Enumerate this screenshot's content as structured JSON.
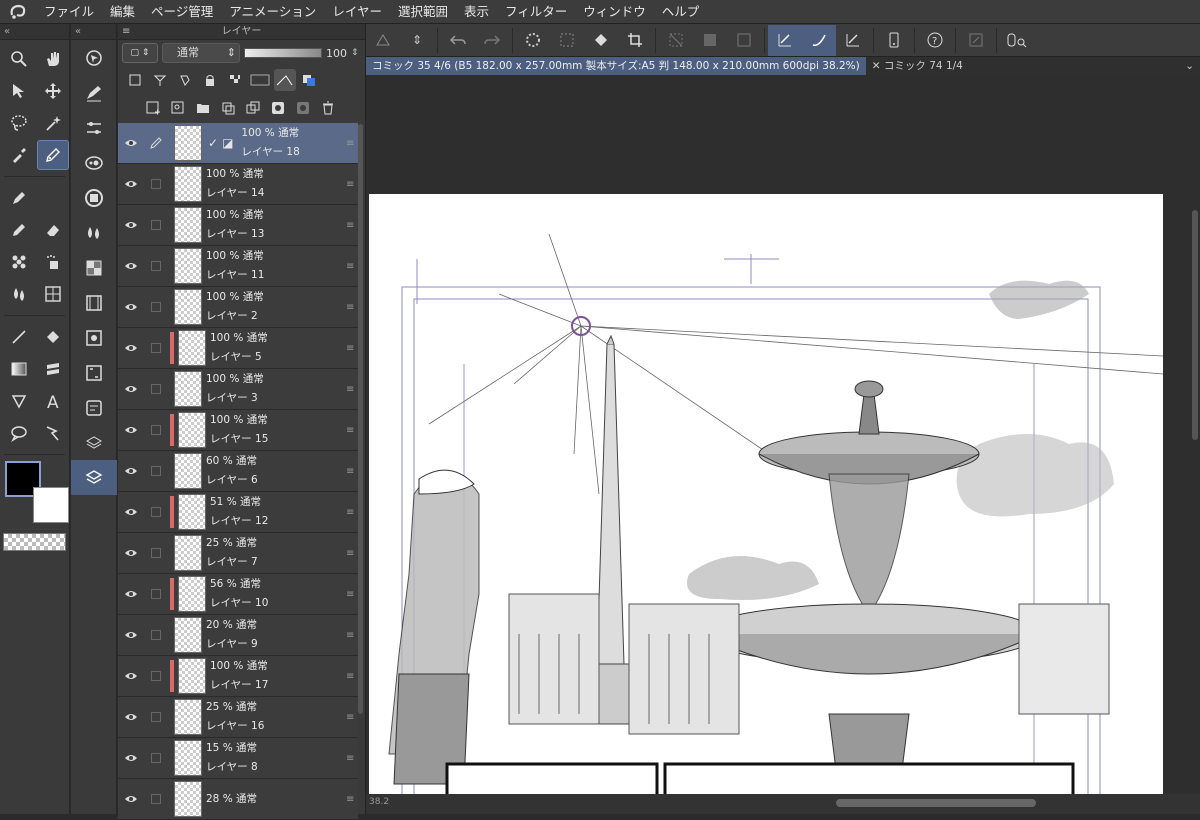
{
  "menu": [
    "ファイル",
    "編集",
    "ページ管理",
    "アニメーション",
    "レイヤー",
    "選択範囲",
    "表示",
    "フィルター",
    "ウィンドウ",
    "ヘルプ"
  ],
  "layer_panel": {
    "title": "レイヤー",
    "blend_mode": "通常",
    "opacity": "100",
    "layers": [
      {
        "percent": "100 % 通常",
        "name": "レイヤー 18",
        "selected": true,
        "marker": false
      },
      {
        "percent": "100 % 通常",
        "name": "レイヤー 14",
        "marker": false
      },
      {
        "percent": "100 % 通常",
        "name": "レイヤー 13",
        "marker": false
      },
      {
        "percent": "100 % 通常",
        "name": "レイヤー 11",
        "marker": false
      },
      {
        "percent": "100 % 通常",
        "name": "レイヤー 2",
        "marker": false
      },
      {
        "percent": "100 % 通常",
        "name": "レイヤー 5",
        "marker": true
      },
      {
        "percent": "100 % 通常",
        "name": "レイヤー 3",
        "marker": false
      },
      {
        "percent": "100 % 通常",
        "name": "レイヤー 15",
        "marker": true
      },
      {
        "percent": "60 % 通常",
        "name": "レイヤー 6",
        "marker": false
      },
      {
        "percent": "51 % 通常",
        "name": "レイヤー 12",
        "marker": true
      },
      {
        "percent": "25 % 通常",
        "name": "レイヤー 7",
        "marker": false
      },
      {
        "percent": "56 % 通常",
        "name": "レイヤー 10",
        "marker": true
      },
      {
        "percent": "20 % 通常",
        "name": "レイヤー 9",
        "marker": false
      },
      {
        "percent": "100 % 通常",
        "name": "レイヤー 17",
        "marker": true
      },
      {
        "percent": "25 % 通常",
        "name": "レイヤー 16",
        "marker": false
      },
      {
        "percent": "15 % 通常",
        "name": "レイヤー 8",
        "marker": false
      },
      {
        "percent": "28 % 通常",
        "name": "",
        "marker": false
      }
    ]
  },
  "tabs": [
    {
      "label": "コミック 35 4/6 (B5 182.00 x 257.00mm 製本サイズ:A5 判 148.00 x 210.00mm 600dpi 38.2%)",
      "active": true
    },
    {
      "label": "コミック 74 1/4",
      "active": false
    }
  ],
  "status": {
    "zoom": "38.2"
  },
  "colors": {
    "accent": "#4d5f80",
    "marker": "#d96a6a",
    "foreground": "#000000",
    "background": "#ffffff"
  }
}
